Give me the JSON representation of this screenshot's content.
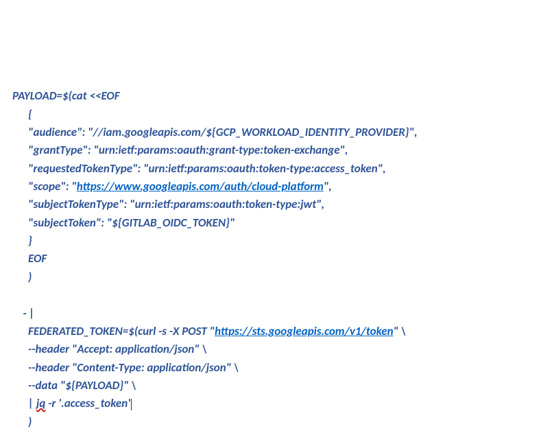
{
  "l1a": "PAYLOAD=$(cat <<EOF",
  "l2a": "      {",
  "l3a": "      \"audience\": \"//iam.googleapis.com/${GCP_WORKLOAD_IDENTITY_PROVIDER}\",",
  "l4a": "      \"grantType\": \"urn:ietf:params:oauth:grant-type:token-exchange\",",
  "l5a": "      \"requestedTokenType\": \"urn:ietf:params:oauth:token-type:access_token\",",
  "l6a": "      \"scope\": \"",
  "l6link": "https://www.googleapis.com/auth/cloud-platform",
  "l6b": "\",",
  "l7a": "      \"subjectTokenType\": \"urn:ietf:params:oauth:token-type:jwt\",",
  "l8a": "      \"subjectToken\": \"${GITLAB_OIDC_TOKEN}\"",
  "l9a": "      }",
  "l10a": "      EOF",
  "l11a": "      )",
  "blank": "",
  "l12a": "    - |",
  "l13a": "      FEDERATED_TOKEN=$(curl -s -X POST \"",
  "l13link": "https://sts.googleapis.com/v1/token",
  "l13b": "\" \\",
  "l14a": "      --header \"Accept: application/json\" \\",
  "l15a": "      --header \"Content-Type: application/json\" \\",
  "l16a": "      --data \"${PAYLOAD}\" \\",
  "l17a": "      | ",
  "l17sq": "jq",
  "l17b": " -r '.access_token'",
  "l18a": "      )"
}
